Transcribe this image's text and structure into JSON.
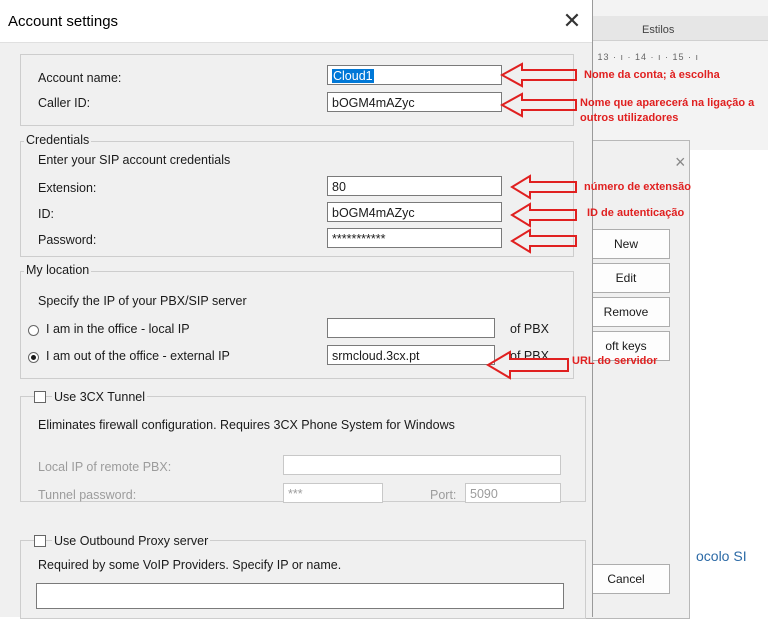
{
  "background_app": {
    "styles_label": "Estilos",
    "ruler_text": "· 13 · ı · 14 · ı · 15 · ı",
    "protocol_text": "ocolo SI",
    "buttons": [
      "New",
      "Edit",
      "Remove",
      "oft keys",
      "Cancel"
    ]
  },
  "dialog": {
    "title": "Account settings",
    "account": {
      "name_label": "Account name:",
      "name_value": "Cloud1",
      "caller_label": "Caller ID:",
      "caller_value": "bOGM4mAZyc"
    },
    "credentials": {
      "title": "Credentials",
      "hint": "Enter your SIP account credentials",
      "extension_label": "Extension:",
      "extension_value": "80",
      "id_label": "ID:",
      "id_value": "bOGM4mAZyc",
      "password_label": "Password:",
      "password_value": "***********"
    },
    "location": {
      "title": "My location",
      "hint": "Specify the IP of your PBX/SIP server",
      "local_label": "I am in the office - local IP",
      "local_value": "",
      "local_suffix": "of PBX",
      "external_label": "I am out of the office - external IP",
      "external_value": "srmcloud.3cx.pt",
      "external_suffix": "of PBX",
      "selected": "external"
    },
    "tunnel": {
      "title": "Use 3CX Tunnel",
      "checked": false,
      "hint": "Eliminates firewall configuration. Requires 3CX Phone System for Windows",
      "local_ip_label": "Local IP of remote PBX:",
      "local_ip_value": "",
      "password_label": "Tunnel password:",
      "password_value": "***",
      "port_label": "Port:",
      "port_value": "5090"
    },
    "proxy": {
      "title": "Use Outbound Proxy server",
      "checked": false,
      "hint": "Required by some VoIP Providers. Specify IP or name.",
      "value": ""
    }
  },
  "annotations": {
    "account_name": "Nome da conta; à escolha",
    "caller_id": "Nome que aparecerá na ligação a outros utilizadores",
    "extension": "número de extensão",
    "auth_id": "ID  de autenticação",
    "server_url": "URL do servidor",
    "color": "#e02020"
  }
}
